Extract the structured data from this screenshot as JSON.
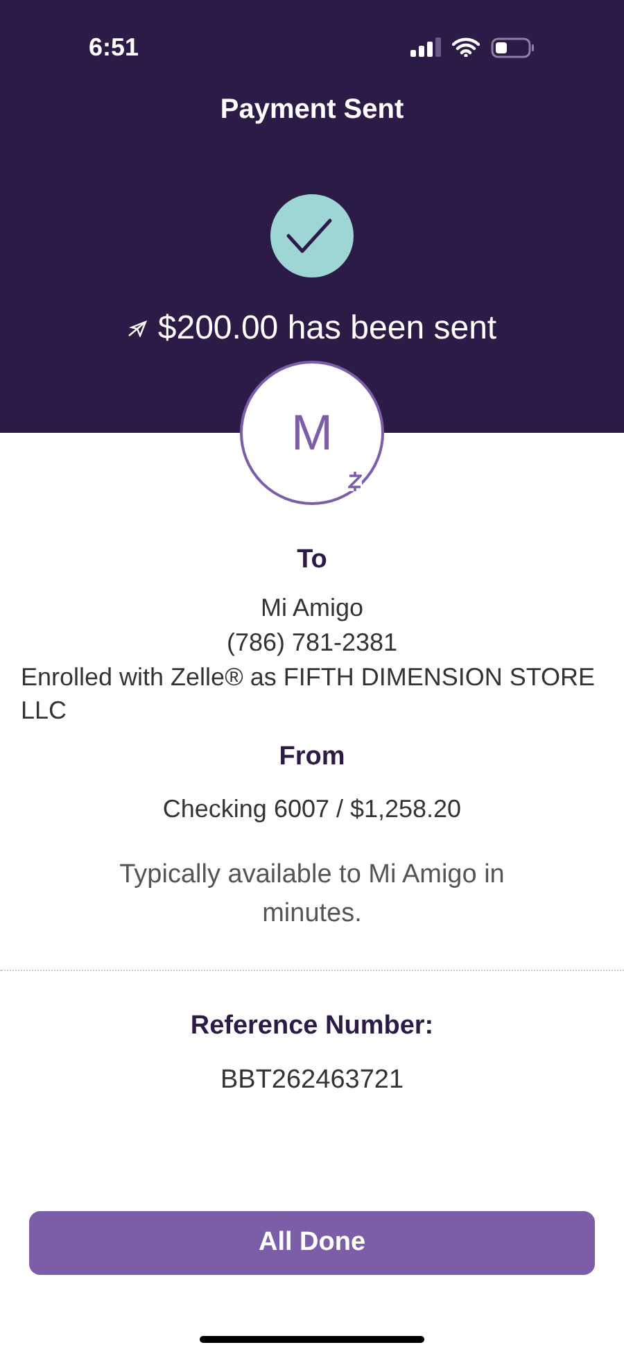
{
  "status_bar": {
    "time": "6:51"
  },
  "header": {
    "title": "Payment Sent",
    "amount_message": "$200.00 has been sent"
  },
  "recipient": {
    "initial": "M",
    "label": "To",
    "name": "Mi Amigo",
    "phone": "(786) 781-2381",
    "enrollment": "Enrolled with Zelle® as FIFTH DIMENSION STORE LLC"
  },
  "sender": {
    "label": "From",
    "account": "Checking 6007 / $1,258.20"
  },
  "availability": "Typically available to Mi Amigo in minutes.",
  "reference": {
    "label": "Reference Number:",
    "value": "BBT262463721"
  },
  "buttons": [
    {
      "label": "All Done",
      "kind": "primary"
    }
  ]
}
